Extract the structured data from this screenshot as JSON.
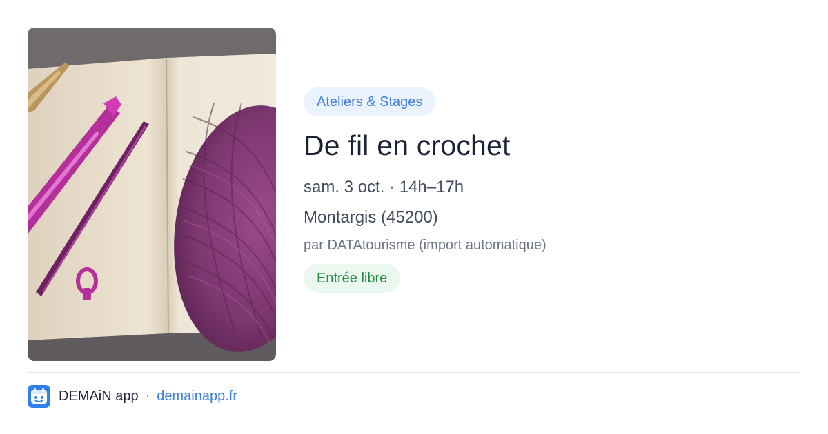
{
  "event": {
    "category": "Ateliers & Stages",
    "title": "De fil en crochet",
    "datetime": "sam. 3 oct. · 14h–17h",
    "location": "Montargis (45200)",
    "source": "par DATAtourisme (import automatique)",
    "price_badge": "Entrée libre"
  },
  "image": {
    "alt": "Pelote de laine violette, crochet et stylo sur un carnet"
  },
  "footer": {
    "app_name": "DEMAiN app",
    "separator": "·",
    "link_text": "demainapp.fr"
  },
  "colors": {
    "accent_blue": "#3f7fd8",
    "category_bg": "#eaf2fd",
    "green_text": "#21873f",
    "green_bg": "#eaf8ef",
    "title_text": "#1a2233",
    "body_text": "#434c5c",
    "muted_text": "#6b7484"
  }
}
